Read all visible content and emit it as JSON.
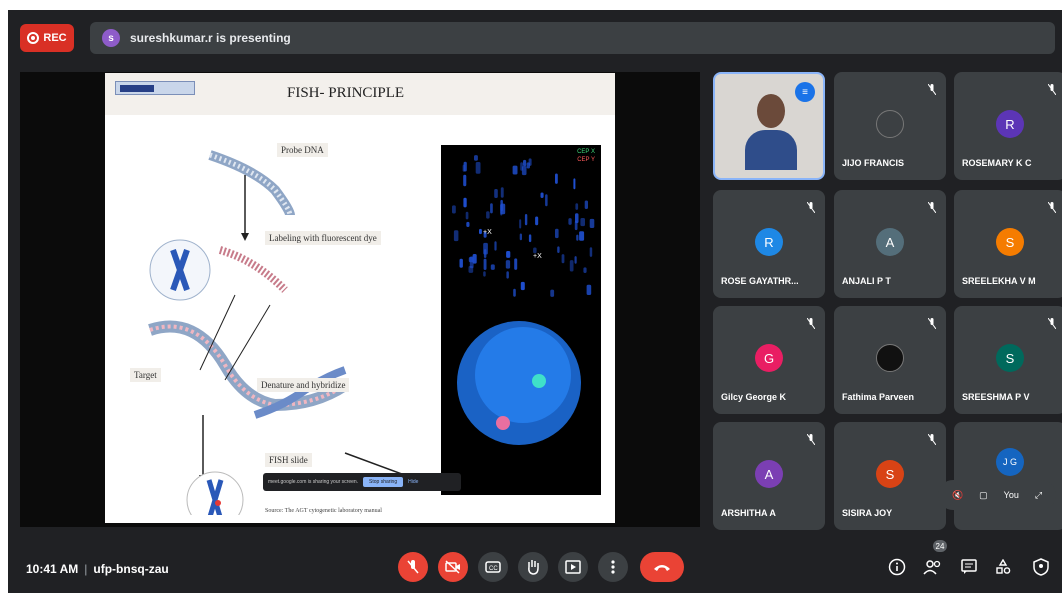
{
  "header": {
    "rec_label": "REC",
    "presenter_initial": "s",
    "presenting_text": "sureshkumar.r is presenting"
  },
  "slide": {
    "title": "FISH- PRINCIPLE",
    "labels": {
      "probe": "Probe DNA",
      "labeling": "Labeling with fluorescent dye",
      "target": "Target",
      "denature": "Denature and hybridize",
      "fish_slide": "FISH slide"
    },
    "fish_legend": [
      "CEP X",
      "CEP Y"
    ],
    "fish_marks": [
      "+X",
      "+X"
    ],
    "source": "Source: The AGT cytogenetic laboratory manual",
    "share_bar": {
      "text": "meet.google.com is sharing your screen.",
      "stop_label": "Stop sharing",
      "hide_label": "Hide"
    }
  },
  "participants": [
    {
      "name": "",
      "type": "video",
      "speaking": true
    },
    {
      "name": "JIJO FRANCIS",
      "type": "photo",
      "initial": "",
      "color": "#3c4043"
    },
    {
      "name": "ROSEMARY K C",
      "type": "initial",
      "initial": "R",
      "color": "#5c35b6"
    },
    {
      "name": "ROSE GAYATHR...",
      "type": "initial",
      "initial": "R",
      "color": "#1e88e5"
    },
    {
      "name": "ANJALI P T",
      "type": "initial",
      "initial": "A",
      "color": "#546e7a"
    },
    {
      "name": "SREELEKHA V M",
      "type": "initial",
      "initial": "S",
      "color": "#f57c00"
    },
    {
      "name": "Gilcy George K",
      "type": "initial",
      "initial": "G",
      "color": "#e91e63"
    },
    {
      "name": "Fathima Parveen",
      "type": "photo",
      "initial": "",
      "color": "#111111"
    },
    {
      "name": "SREESHMA P V",
      "type": "initial",
      "initial": "S",
      "color": "#00695c"
    },
    {
      "name": "ARSHITHA A",
      "type": "initial",
      "initial": "A",
      "color": "#7b3fb3"
    },
    {
      "name": "SISIRA JOY",
      "type": "initial",
      "initial": "S",
      "color": "#d84315"
    },
    {
      "name": "",
      "type": "self",
      "initial": "J G",
      "color": "#1565c0"
    }
  ],
  "self_view": {
    "label": "You"
  },
  "bottom": {
    "time": "10:41 AM",
    "meeting_code": "ufp-bnsq-zau",
    "people_count": "24",
    "icons": {
      "mic": "mic-off-icon",
      "camera": "camera-off-icon",
      "captions": "captions-icon",
      "hand": "raise-hand-icon",
      "present": "present-icon",
      "more": "more-vert-icon",
      "end": "end-call-icon",
      "info": "info-icon",
      "people": "people-icon",
      "chat": "chat-icon",
      "activities": "activities-icon",
      "security": "shield-icon"
    }
  },
  "colors": {
    "background": "#202124",
    "tile": "#3c4043",
    "red": "#ea4335",
    "accent": "#8ab4f8"
  }
}
